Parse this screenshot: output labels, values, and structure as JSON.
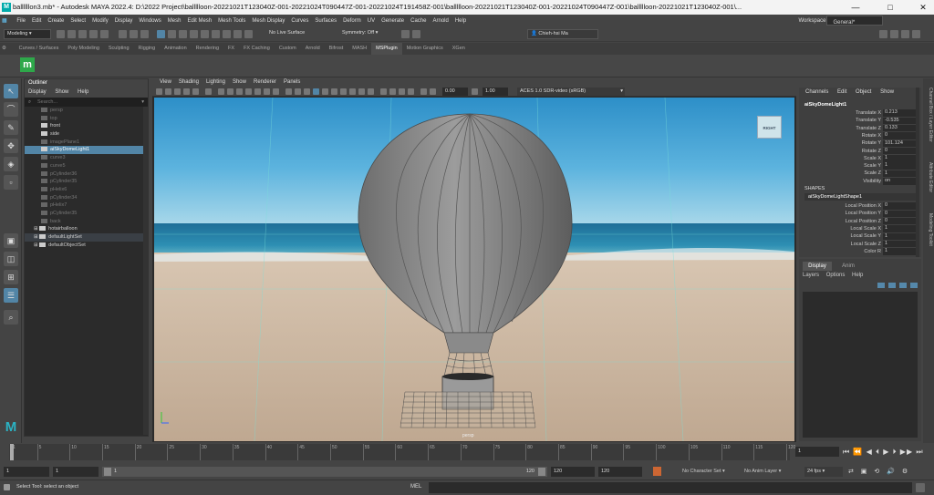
{
  "window": {
    "title": "ballllllon3.mb* - Autodesk MAYA 2022.4: D:\\2022 Project\\ballllloon-20221021T123040Z-001-20221024T090447Z-001-20221024T191458Z-001\\ballllloon-20221021T123040Z-001-20221024T090447Z-001\\ballllloon-20221021T123040Z-001\\...",
    "minimize": "—",
    "maximize": "□",
    "close": "✕"
  },
  "menubar": {
    "items": [
      "File",
      "Edit",
      "Create",
      "Select",
      "Modify",
      "Display",
      "Windows",
      "Mesh",
      "Edit Mesh",
      "Mesh Tools",
      "Mesh Display",
      "Curves",
      "Surfaces",
      "Deform",
      "UV",
      "Generate",
      "Cache",
      "Arnold",
      "Help"
    ],
    "workspace_label": "Workspace:",
    "workspace_value": "General*"
  },
  "statusline": {
    "mode": "Modeling",
    "live_surface": "No Live Surface",
    "symmetry": "Symmetry: Off",
    "user": "Chieh-hsi Ma"
  },
  "shelf": {
    "tabs": [
      "Curves / Surfaces",
      "Poly Modeling",
      "Sculpting",
      "Rigging",
      "Animation",
      "Rendering",
      "FX",
      "FX Caching",
      "Custom",
      "Arnold",
      "Bifrost",
      "MASH",
      "MSPlugin",
      "Motion Graphics",
      "XGen"
    ],
    "active": "MSPlugin"
  },
  "outliner": {
    "title": "Outliner",
    "menu": [
      "Display",
      "Show",
      "Help"
    ],
    "search_placeholder": "Search...",
    "items": [
      {
        "label": "persp",
        "state": "dim"
      },
      {
        "label": "top",
        "state": "dim"
      },
      {
        "label": "front",
        "state": "normal"
      },
      {
        "label": "side",
        "state": "normal"
      },
      {
        "label": "imagePlane1",
        "state": "dim"
      },
      {
        "label": "aiSkyDomeLight1",
        "state": "selected"
      },
      {
        "label": "curve3",
        "state": "dim"
      },
      {
        "label": "curve5",
        "state": "dim"
      },
      {
        "label": "pCylinder36",
        "state": "dim"
      },
      {
        "label": "pCylinder35",
        "state": "dim"
      },
      {
        "label": "pHelix6",
        "state": "dim"
      },
      {
        "label": "pCylinder34",
        "state": "dim"
      },
      {
        "label": "pHelix7",
        "state": "dim"
      },
      {
        "label": "pCylinder35",
        "state": "dim"
      },
      {
        "label": "back",
        "state": "dim"
      },
      {
        "label": "hotairballoon",
        "state": "normal"
      },
      {
        "label": "defaultLightSet",
        "state": "set"
      },
      {
        "label": "defaultObjectSet",
        "state": "normal"
      }
    ]
  },
  "viewport": {
    "menu": [
      "View",
      "Shading",
      "Lighting",
      "Show",
      "Renderer",
      "Panels"
    ],
    "exposure": "0.00",
    "gamma": "1.00",
    "colorspace": "ACES 1.0 SDR-video (sRGB)",
    "viewcube": "RIGHT",
    "camera": "persp"
  },
  "channelbox": {
    "menu": [
      "Channels",
      "Edit",
      "Object",
      "Show"
    ],
    "node": "aiSkyDomeLight1",
    "attrs": [
      {
        "label": "Translate X",
        "value": "0.213"
      },
      {
        "label": "Translate Y",
        "value": "-0.535"
      },
      {
        "label": "Translate Z",
        "value": "0.133"
      },
      {
        "label": "Rotate X",
        "value": "0"
      },
      {
        "label": "Rotate Y",
        "value": "101.124"
      },
      {
        "label": "Rotate Z",
        "value": "0"
      },
      {
        "label": "Scale X",
        "value": "1"
      },
      {
        "label": "Scale Y",
        "value": "1"
      },
      {
        "label": "Scale Z",
        "value": "1"
      },
      {
        "label": "Visibility",
        "value": "on"
      }
    ],
    "shapes_title": "SHAPES",
    "shape_node": "aiSkyDomeLightShape1",
    "shape_attrs": [
      {
        "label": "Local Position X",
        "value": "0"
      },
      {
        "label": "Local Position Y",
        "value": "0"
      },
      {
        "label": "Local Position Z",
        "value": "0"
      },
      {
        "label": "Local Scale X",
        "value": "1"
      },
      {
        "label": "Local Scale Y",
        "value": "1"
      },
      {
        "label": "Local Scale Z",
        "value": "1"
      },
      {
        "label": "Color R",
        "value": "1"
      }
    ]
  },
  "layer_panel": {
    "tabs": [
      "Display",
      "Anim"
    ],
    "menu": [
      "Layers",
      "Options",
      "Help"
    ]
  },
  "side_tabs": [
    "Channel Box / Layer Editor",
    "Attribute Editor",
    "Modeling Toolkit"
  ],
  "timeline": {
    "ticks": [
      "1",
      "5",
      "10",
      "15",
      "20",
      "25",
      "30",
      "35",
      "40",
      "45",
      "50",
      "55",
      "60",
      "65",
      "70",
      "75",
      "80",
      "85",
      "90",
      "95",
      "100",
      "105",
      "110",
      "115",
      "120"
    ],
    "current_frame": "1"
  },
  "range": {
    "start": "1",
    "start2": "1",
    "range_label": "1",
    "range_end": "120",
    "end": "120",
    "end2": "120",
    "character_set": "No Character Set",
    "anim_layer": "No Anim Layer",
    "fps": "24 fps"
  },
  "command": {
    "help": "Select Tool: select an object",
    "lang": "MEL"
  }
}
